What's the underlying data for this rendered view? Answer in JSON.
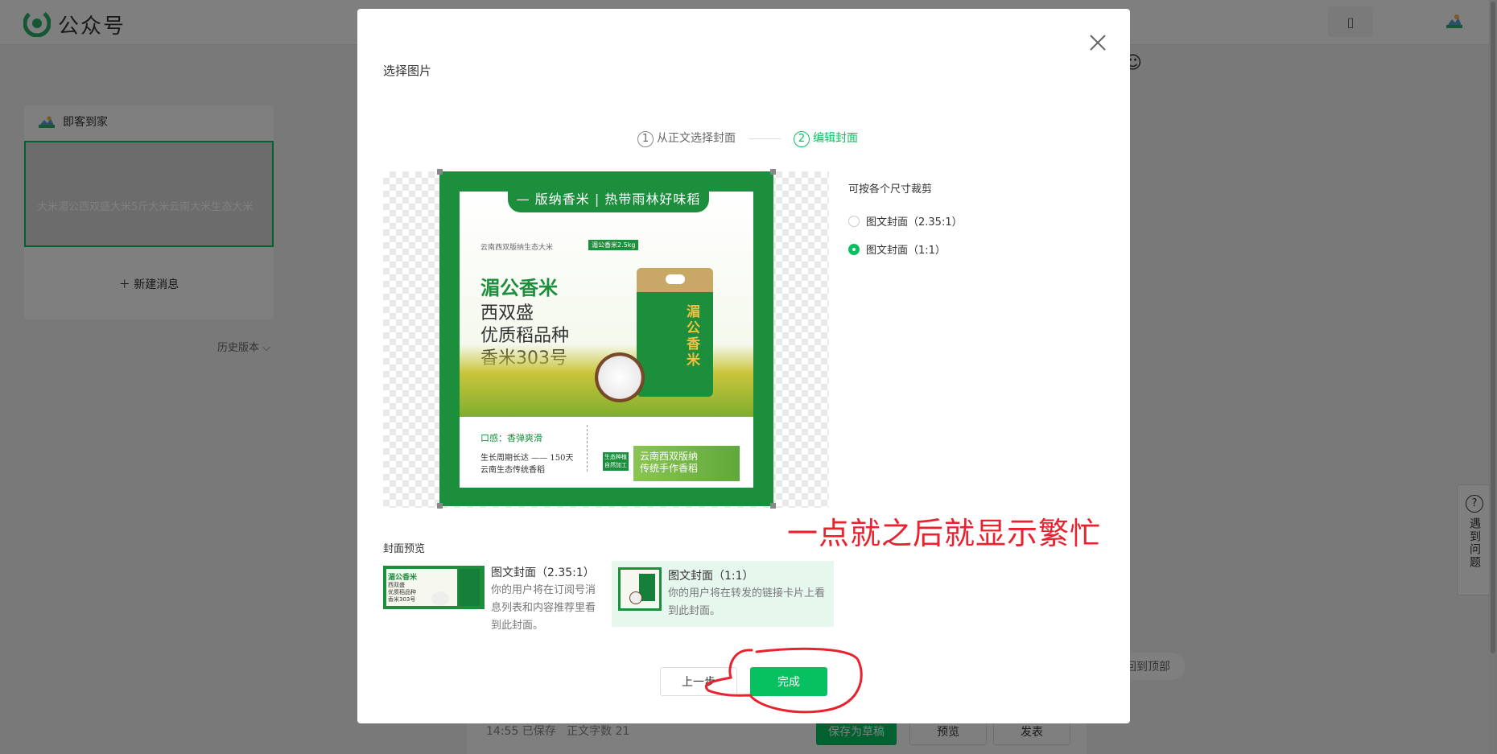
{
  "app": {
    "title": "公众号",
    "accent_color": "#07c160"
  },
  "topbar": {
    "notice_icon": "document-icon",
    "avatar_icon": "avatar-icon"
  },
  "sidebar": {
    "account_name": "即客到家",
    "article_title": "大米湄公西双盛大米5斤大米云南大米生态大米",
    "new_message": "新建消息",
    "history": "历史版本"
  },
  "editor": {
    "save_status": "14:55 已保存",
    "word_count": "正文字数 21",
    "save_draft": "保存为草稿",
    "preview": "预览",
    "publish": "发表",
    "back_to_top": "回到顶部",
    "help": "遇到问题"
  },
  "modal": {
    "title": "选择图片",
    "steps": [
      {
        "num": "1",
        "label": "从正文选择封面",
        "active": false
      },
      {
        "num": "2",
        "label": "编辑封面",
        "active": true
      }
    ],
    "crop_title": "可按各个尺寸裁剪",
    "crop_options": [
      {
        "label": "图文封面（2.35:1）",
        "checked": false
      },
      {
        "label": "图文封面（1:1）",
        "checked": true
      }
    ],
    "poster": {
      "banner": "— 版纳香米 | 热带雨林好味稻 —",
      "small": "云南西双版纳生态大米",
      "tag": "湄公香米2.5kg",
      "brand": "湄公香米",
      "lines": [
        "西双盛",
        "优质稻品种",
        "香米303号"
      ],
      "bag_label": "湄公香米",
      "taste": "口感：香弹爽滑",
      "cycle": [
        "生长周期长达 —— 150天",
        "云南生态传统香稻"
      ],
      "badge": "生态种植自然加工",
      "right_text": [
        "云南西双版纳",
        "传统手作香稻"
      ]
    },
    "preview_label": "封面预览",
    "previews": [
      {
        "title": "图文封面（2.35:1）",
        "desc": "你的用户将在订阅号消息列表和内容推荐里看到此封面。"
      },
      {
        "title": "图文封面（1:1）",
        "desc": "你的用户将在转发的链接卡片上看到此封面。"
      }
    ],
    "prev_button": "上一步",
    "done_button": "完成"
  },
  "annotation": {
    "text": "一点就之后就显示繁忙",
    "color": "#e8222e"
  }
}
